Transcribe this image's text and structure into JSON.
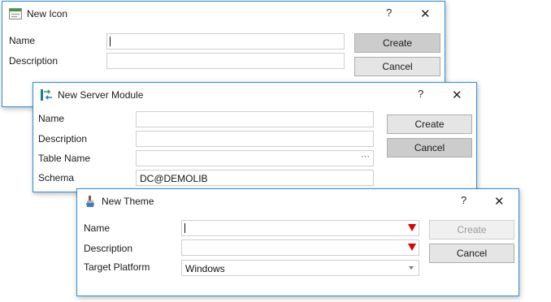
{
  "new_icon": {
    "title": "New Icon",
    "help": "?",
    "close": "✕",
    "labels": {
      "name": "Name",
      "description": "Description"
    },
    "values": {
      "name": "",
      "description": ""
    },
    "buttons": {
      "create": "Create",
      "cancel": "Cancel"
    }
  },
  "new_server_module": {
    "title": "New Server Module",
    "help": "?",
    "close": "✕",
    "labels": {
      "name": "Name",
      "description": "Description",
      "table_name": "Table Name",
      "schema": "Schema"
    },
    "values": {
      "name": "",
      "description": "",
      "table_name": "",
      "schema": "DC@DEMOLIB"
    },
    "browse_label": "···",
    "buttons": {
      "create": "Create",
      "cancel": "Cancel"
    }
  },
  "new_theme": {
    "title": "New Theme",
    "help": "?",
    "close": "✕",
    "labels": {
      "name": "Name",
      "description": "Description",
      "target_platform": "Target Platform"
    },
    "values": {
      "name": "",
      "description": "",
      "target_platform": "Windows"
    },
    "buttons": {
      "create": "Create",
      "cancel": "Cancel"
    }
  },
  "colors": {
    "accent": "#2f8fd8",
    "required": "#e00000"
  },
  "icons": {
    "new_icon": "window-icon",
    "new_server_module": "server-module-icon",
    "new_theme": "paint-brush-icon"
  }
}
